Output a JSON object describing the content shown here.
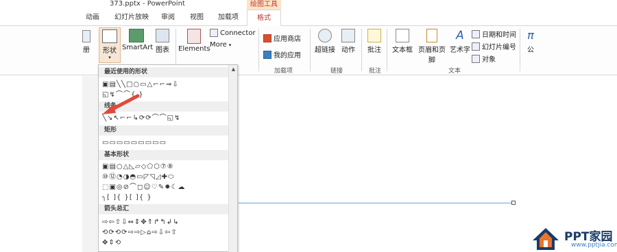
{
  "title": "373.pptx - PowerPoint",
  "ctx_tab": "绘图工具",
  "tabs": [
    {
      "label": "动画"
    },
    {
      "label": "幻灯片放映"
    },
    {
      "label": "审阅"
    },
    {
      "label": "视图"
    },
    {
      "label": "加载项"
    },
    {
      "label": "格式"
    }
  ],
  "ribbon": {
    "cut_label": "册",
    "shapes": "形状",
    "smartart": "SmartArt",
    "chart": "图表",
    "elements": "Elements",
    "connector": "Connector",
    "more": "More",
    "app_store": "应用商店",
    "my_apps": "我的应用",
    "hyperlink": "超链接",
    "action": "动作",
    "comment": "批注",
    "textbox": "文本框",
    "header_footer": "页眉和页脚",
    "wordart": "艺术字",
    "datetime": "日期和时间",
    "slide_number": "幻灯片编号",
    "object": "对象",
    "formula": "公",
    "groups": {
      "addins": "加载项",
      "links": "链接",
      "comments": "批注",
      "text": "文本"
    }
  },
  "panel": {
    "recent": "最近使用的形状",
    "lines": "线条",
    "rect": "矩形",
    "basic": "基本形状",
    "arrows": "箭头总汇"
  },
  "watermark": {
    "brand": "PPT家园",
    "site": "www.pptjia.com"
  },
  "colors": {
    "accent": "#c0392b",
    "line": "#6aa2d8",
    "arrow": "#e04a3a"
  }
}
